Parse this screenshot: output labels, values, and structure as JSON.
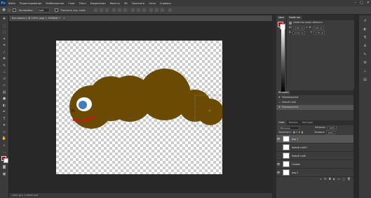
{
  "app": {
    "logo": "Ps"
  },
  "menu": [
    "Файл",
    "Редактирование",
    "Изображение",
    "Слои",
    "Текст",
    "Выделение",
    "Фильтр",
    "3D",
    "Просмотр",
    "Окно",
    "Справка"
  ],
  "window_controls": {
    "minimize": "–",
    "maximize": "□",
    "close": "✕"
  },
  "options_bar": {
    "autoselect_label": "Автовыбор:",
    "autoselect_value": "Слой",
    "transform_label": "Показать упр. элем."
  },
  "document": {
    "tab_title": "Без имени-1 @ 100% (ряд 1, RGB/8#) *",
    "status_text": "100%  Док: 1,24M/5,13M"
  },
  "colors": {
    "body": "#6b4a04",
    "body_dark": "#5a3e03",
    "eye_white": "#ffffff",
    "iris": "#3f7dbd",
    "mouth": "#c41818",
    "foreground": "#c00000",
    "background": "#ffffff"
  },
  "panels": {
    "color_tabs": [
      "Цвет",
      "Образцы"
    ],
    "properties_tab": "Свойства",
    "properties_title": "Свойства смарт-объекта",
    "props": {
      "w_label": "Ш:",
      "w_value": "0,95 см",
      "h_label": "В:",
      "h_value": "0,65 см",
      "x_label": "X:",
      "x_value": "11,01 см",
      "y_label": "Y:",
      "y_value": "3,79 см"
    },
    "history_tab": "История",
    "history_items": [
      "Перемещение",
      "Новый слой",
      "Перемещение"
    ],
    "layers_tabs": [
      "Слои",
      "Каналы",
      "Контуры"
    ],
    "blend_mode": "Обычные",
    "opacity_label": "Непрозр.:",
    "opacity_value": "100%",
    "lock_label": "Закрепить:",
    "fill_label": "Заливка:",
    "fill_value": "100%",
    "layers": [
      "ряд 1",
      "Новый слой 1",
      "Новый слой",
      "Голова",
      "ряд 2"
    ]
  },
  "right_icons": [
    "history-icon",
    "adjustments-icon",
    "paragraph-icon",
    "character-icon",
    "brush-icon",
    "tool-presets-icon",
    "clone-icon",
    "timeline-icon"
  ]
}
